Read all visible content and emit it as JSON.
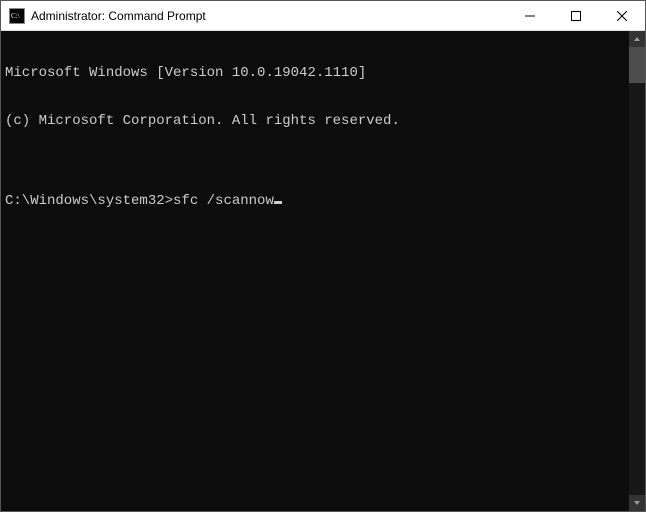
{
  "titlebar": {
    "title": "Administrator: Command Prompt",
    "icon": "cmd-icon",
    "minimize": "minimize",
    "maximize": "maximize",
    "close": "close"
  },
  "console": {
    "line1": "Microsoft Windows [Version 10.0.19042.1110]",
    "line2": "(c) Microsoft Corporation. All rights reserved.",
    "blank": "",
    "prompt": "C:\\Windows\\system32>",
    "command": "sfc /scannow"
  },
  "colors": {
    "console_bg": "#0c0c0c",
    "console_fg": "#cccccc"
  }
}
